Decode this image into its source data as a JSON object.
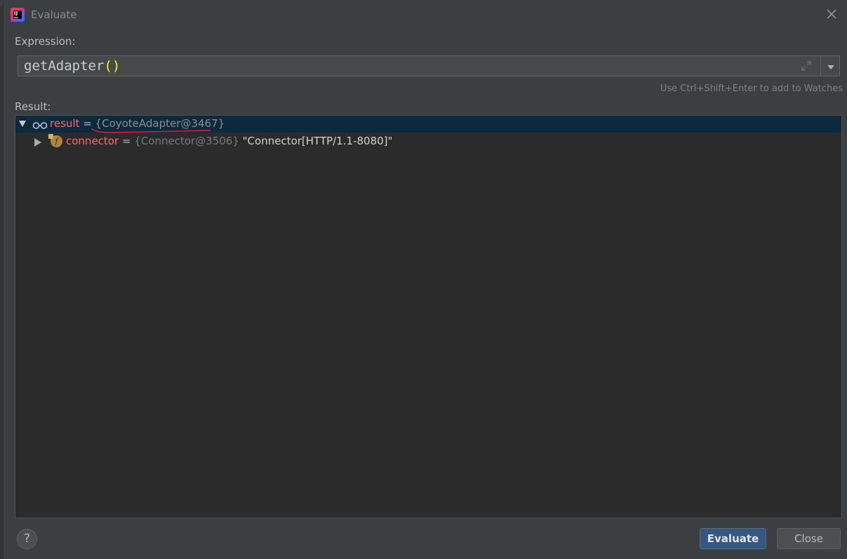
{
  "window": {
    "title": "Evaluate"
  },
  "expression": {
    "label": "Expression:",
    "method": "getAdapter",
    "parens": "()",
    "hint": "Use Ctrl+Shift+Enter to add to Watches"
  },
  "result": {
    "label": "Result:",
    "rows": [
      {
        "name": "result",
        "eq": " = ",
        "ref": "{CoyoteAdapter@3467}",
        "value": "",
        "expanded": true,
        "selected": true,
        "icon": "watch-glasses-icon"
      },
      {
        "name": "connector",
        "eq": " = ",
        "ref": "{Connector@3506}",
        "value": " \"Connector[HTTP/1.1-8080]\"",
        "expanded": false,
        "selected": false,
        "icon": "field-f-icon",
        "icon_letter": "f"
      }
    ]
  },
  "buttons": {
    "help": "?",
    "evaluate": "Evaluate",
    "close": "Close"
  },
  "colors": {
    "dialog_bg": "#3c3f41",
    "panel_bg": "#2b2b2b",
    "selection": "#0d293e",
    "var_name": "#ff6b68",
    "paren": "#ffef28",
    "primary_button": "#365880",
    "annotation_underline": "#e0213a"
  }
}
